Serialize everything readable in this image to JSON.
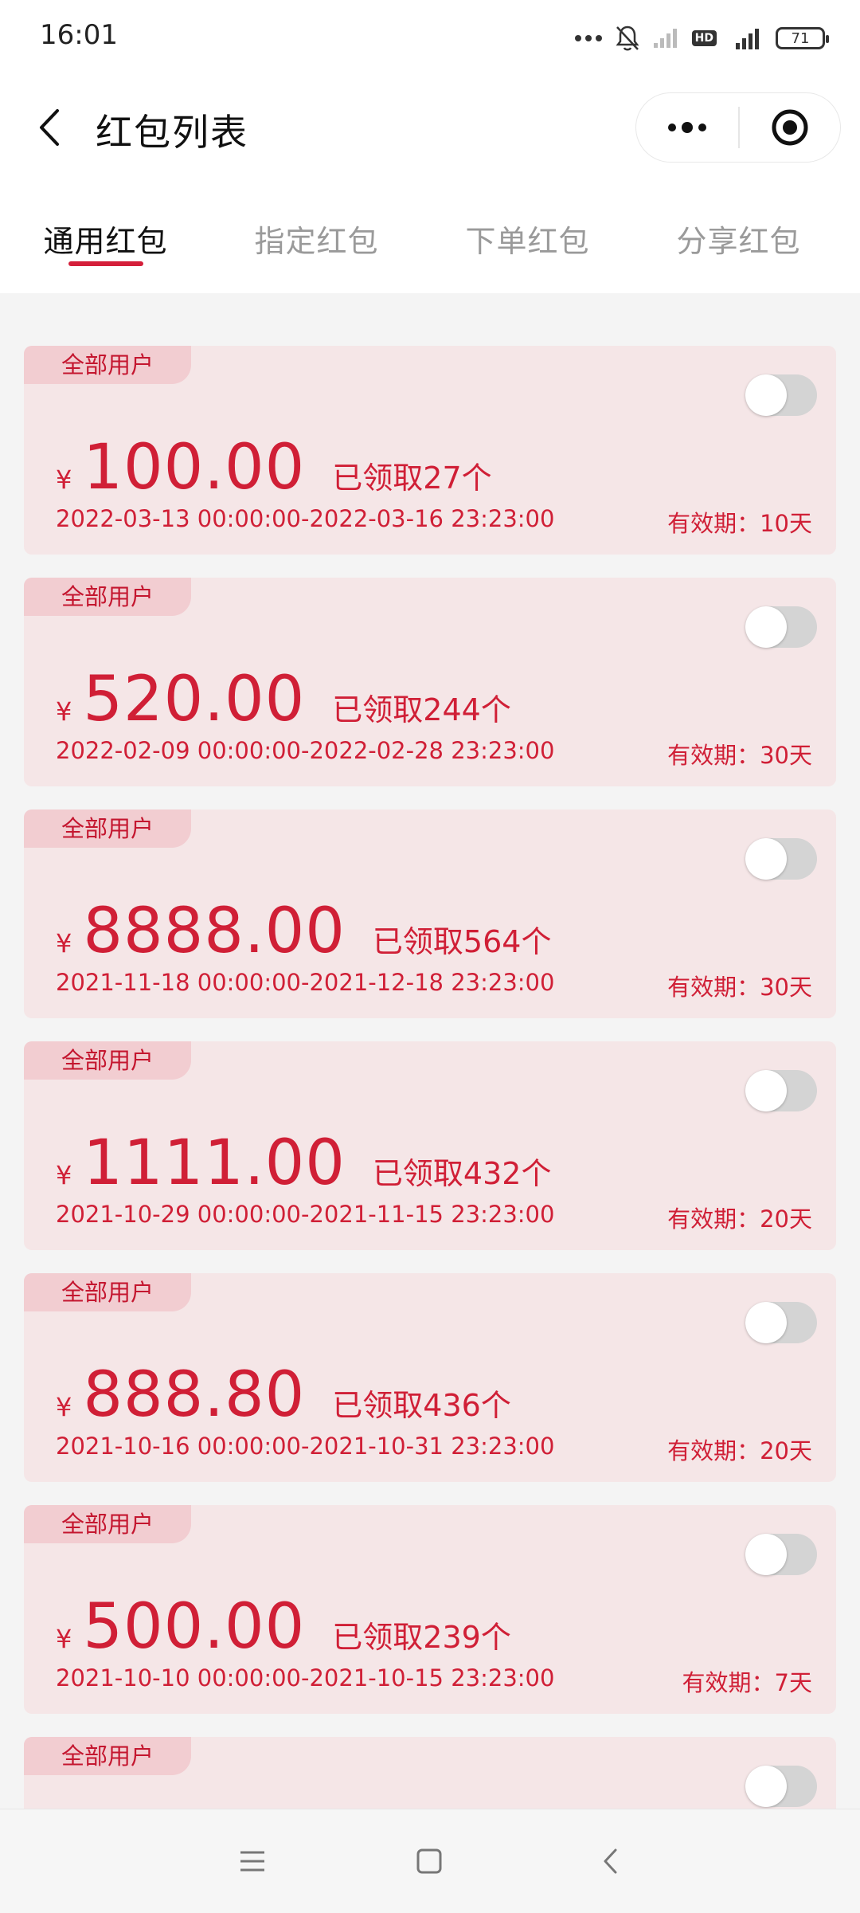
{
  "status_bar": {
    "time": "16:01",
    "network": "4G",
    "hd": "HD",
    "battery": "71"
  },
  "header": {
    "title": "红包列表"
  },
  "tabs": [
    {
      "label": "通用红包",
      "active": true
    },
    {
      "label": "指定红包",
      "active": false
    },
    {
      "label": "下单红包",
      "active": false
    },
    {
      "label": "分享红包",
      "active": false
    }
  ],
  "cards": [
    {
      "tag": "全部用户",
      "currency": "¥",
      "amount": "100.00",
      "claimed": "已领取27个",
      "range": "2022-03-13 00:00:00-2022-03-16 23:23:00",
      "validity": "有效期：10天",
      "enabled": false
    },
    {
      "tag": "全部用户",
      "currency": "¥",
      "amount": "520.00",
      "claimed": "已领取244个",
      "range": "2022-02-09 00:00:00-2022-02-28 23:23:00",
      "validity": "有效期：30天",
      "enabled": false
    },
    {
      "tag": "全部用户",
      "currency": "¥",
      "amount": "8888.00",
      "claimed": "已领取564个",
      "range": "2021-11-18 00:00:00-2021-12-18 23:23:00",
      "validity": "有效期：30天",
      "enabled": false
    },
    {
      "tag": "全部用户",
      "currency": "¥",
      "amount": "1111.00",
      "claimed": "已领取432个",
      "range": "2021-10-29 00:00:00-2021-11-15 23:23:00",
      "validity": "有效期：20天",
      "enabled": false
    },
    {
      "tag": "全部用户",
      "currency": "¥",
      "amount": "888.80",
      "claimed": "已领取436个",
      "range": "2021-10-16 00:00:00-2021-10-31 23:23:00",
      "validity": "有效期：20天",
      "enabled": false
    },
    {
      "tag": "全部用户",
      "currency": "¥",
      "amount": "500.00",
      "claimed": "已领取239个",
      "range": "2021-10-10 00:00:00-2021-10-15 23:23:00",
      "validity": "有效期：7天",
      "enabled": false
    },
    {
      "tag": "全部用户",
      "enabled": false
    }
  ],
  "colors": {
    "accent": "#d01f36",
    "card_bg": "#f5e6e7",
    "tag_bg": "#f2cdd1",
    "toggle_off": "#d4d4d4"
  }
}
